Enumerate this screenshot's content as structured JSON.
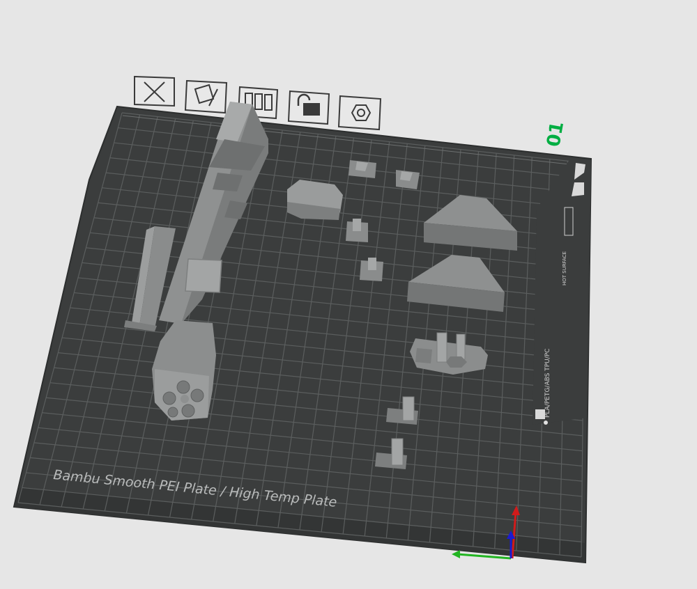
{
  "plate": {
    "number": "01",
    "name_label": "Bambu Smooth PEI Plate / High Temp Plate",
    "side_label_materials": "PLA/PETG/ABS TPU/PC",
    "side_label_warning": "HOT SURFACE"
  },
  "toolbar": {
    "buttons": [
      {
        "name": "delete-plate-button",
        "icon": "close-icon"
      },
      {
        "name": "plate-settings-button",
        "icon": "pencil-icon"
      },
      {
        "name": "arrange-button",
        "icon": "arrange-icon"
      },
      {
        "name": "lock-button",
        "icon": "lock-icon"
      },
      {
        "name": "slice-plate-button",
        "icon": "hexagon-icon"
      }
    ]
  },
  "axes": {
    "x_color": "#22b522",
    "y_color": "#d11b1b",
    "z_color": "#1b1bd1"
  },
  "colors": {
    "plate_number": "#00ae42",
    "plate": "#3b3d3d",
    "grid": "#5a5c5c",
    "model": "#9a9c9c",
    "background": "#e6e6e6"
  }
}
